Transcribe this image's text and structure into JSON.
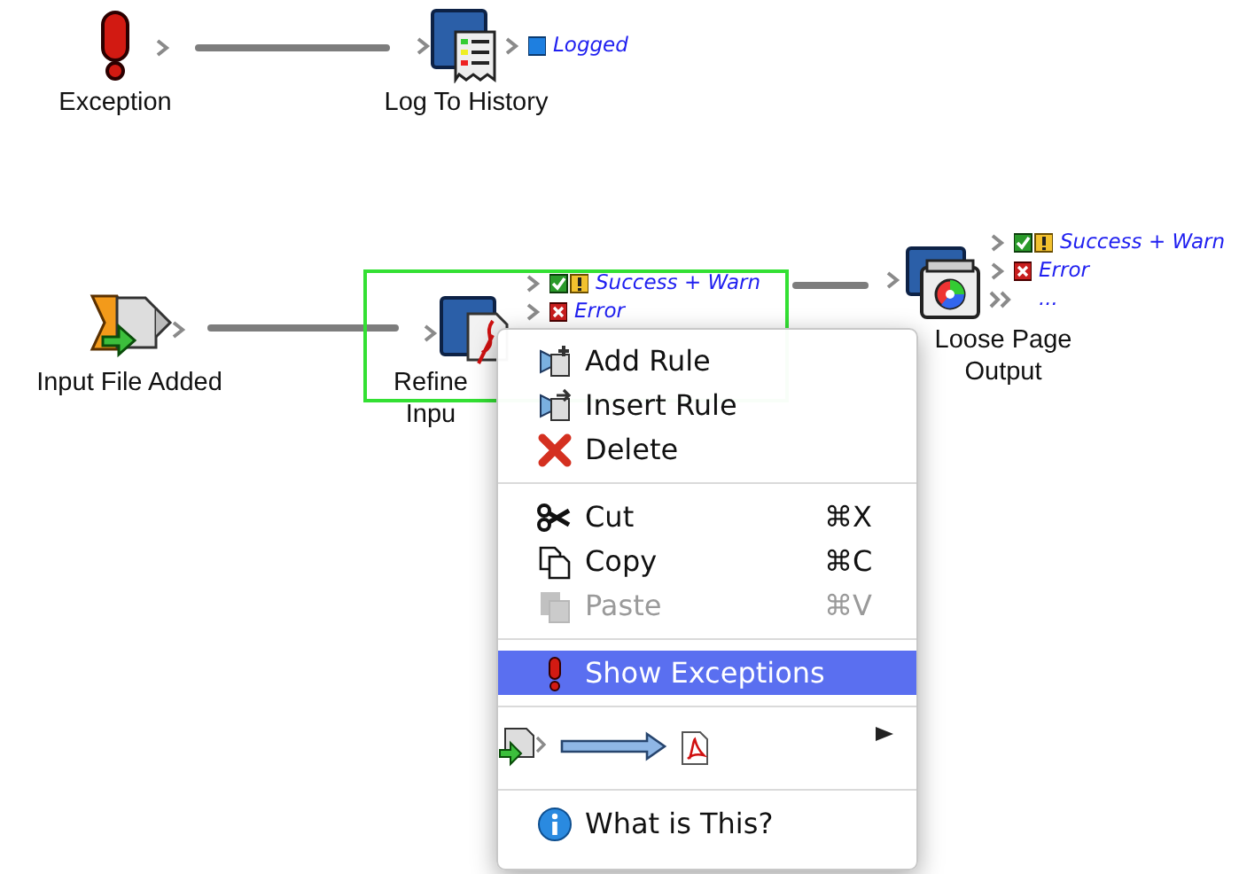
{
  "nodes": [
    {
      "label": "Exception",
      "selected": false,
      "outputs": [
        {
          "kind": "plain"
        }
      ]
    },
    {
      "label": "Log To History",
      "selected": false,
      "outputs": [
        {
          "kind": "logged",
          "label": "Logged"
        }
      ]
    },
    {
      "label": "Input File Added",
      "selected": false,
      "outputs": [
        {
          "kind": "plain"
        }
      ]
    },
    {
      "label": "Refine Inpu",
      "selected": true,
      "outputs": [
        {
          "kind": "success-warn",
          "label": "Success + Warn"
        },
        {
          "kind": "error",
          "label": "Error"
        }
      ]
    },
    {
      "label": "Loose Page Output",
      "selected": false,
      "outputs": [
        {
          "kind": "success-warn",
          "label": "Success + Warn"
        },
        {
          "kind": "error",
          "label": "Error"
        },
        {
          "kind": "more",
          "label": "..."
        }
      ]
    }
  ],
  "context_menu": {
    "items": [
      {
        "kind": "item",
        "label": "Add Rule",
        "disabled": false,
        "selected": false
      },
      {
        "kind": "item",
        "label": "Insert Rule",
        "disabled": false,
        "selected": false
      },
      {
        "kind": "item",
        "label": "Delete",
        "disabled": false,
        "selected": false
      },
      {
        "kind": "separator"
      },
      {
        "kind": "item",
        "label": "Cut",
        "shortcut": "⌘X",
        "disabled": false,
        "selected": false
      },
      {
        "kind": "item",
        "label": "Copy",
        "shortcut": "⌘C",
        "disabled": false,
        "selected": false
      },
      {
        "kind": "item",
        "label": "Paste",
        "shortcut": "⌘V",
        "disabled": true,
        "selected": false
      },
      {
        "kind": "separator"
      },
      {
        "kind": "item",
        "label": "Show Exceptions",
        "disabled": false,
        "selected": true
      },
      {
        "kind": "separator"
      },
      {
        "kind": "submenu",
        "disabled": false,
        "selected": false
      },
      {
        "kind": "separator"
      },
      {
        "kind": "item",
        "label": "What is This?",
        "disabled": false,
        "selected": false
      }
    ]
  }
}
